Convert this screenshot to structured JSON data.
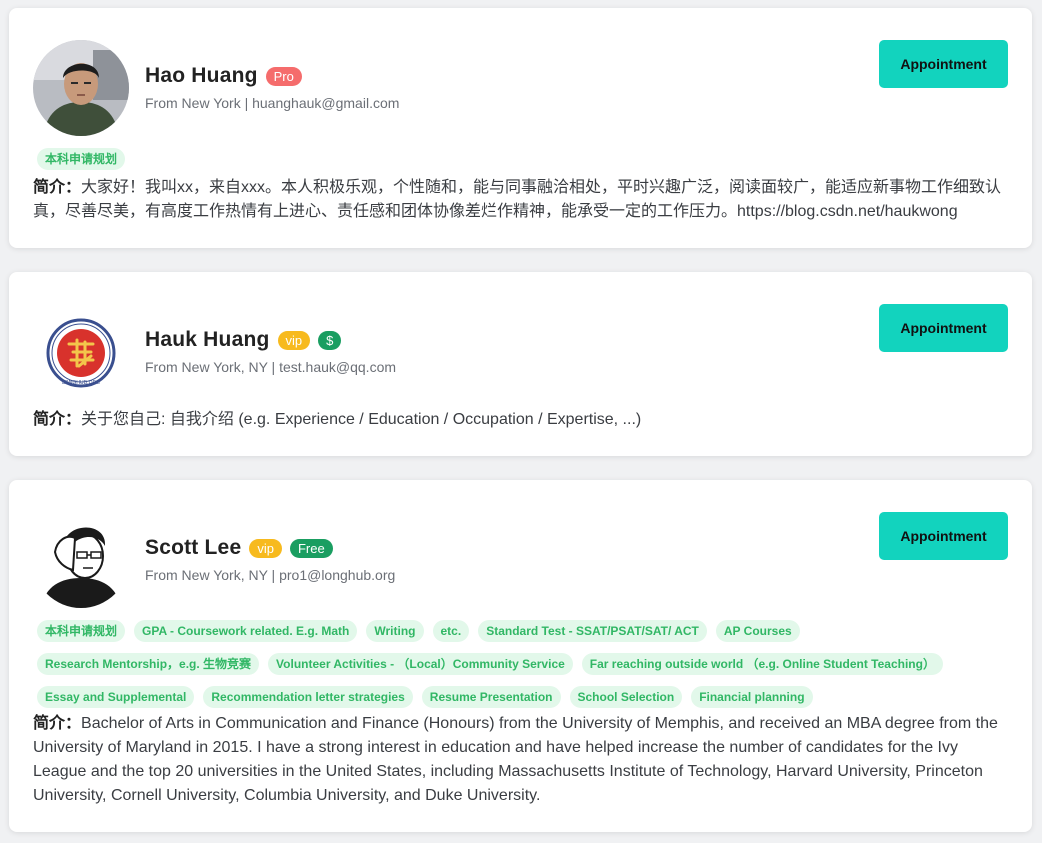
{
  "cards": [
    {
      "name": "Hao Huang",
      "badges": [
        "Pro"
      ],
      "from": "From New York | huanghauk@gmail.com",
      "appointment_label": "Appointment",
      "tags": [
        "本科申请规划"
      ],
      "bio_label": "简介：",
      "bio": "大家好！我叫xx，来自xxx。本人积极乐观，个性随和，能与同事融洽相处，平时兴趣广泛，阅读面较广，能适应新事物工作细致认真，尽善尽美，有高度工作热情有上进心、责任感和团体协像差烂作精神，能承受一定的工作压力。https://blog.csdn.net/haukwong"
    },
    {
      "name": "Hauk Huang",
      "badges": [
        "vip",
        "$"
      ],
      "from": "From New York, NY | test.hauk@qq.com",
      "appointment_label": "Appointment",
      "tags": [],
      "bio_label": "简介：",
      "bio": "关于您自己: 自我介绍 (e.g. Experience / Education / Occupation / Expertise, ...)",
      "logo_text": "LONGHUB.ORG"
    },
    {
      "name": "Scott Lee",
      "badges": [
        "vip",
        "Free"
      ],
      "from": "From New York, NY | pro1@longhub.org",
      "appointment_label": "Appointment",
      "tags": [
        "本科申请规划",
        "GPA - Coursework related. E.g. Math",
        "Writing",
        "etc.",
        "Standard Test - SSAT/PSAT/SAT/ ACT",
        "AP Courses",
        "Research Mentorship，e.g. 生物竞赛",
        "Volunteer Activities - （Local）Community Service",
        "Far reaching outside world （e.g. Online Student Teaching）",
        "Essay and Supplemental",
        "Recommendation letter strategies",
        "Resume Presentation",
        "School Selection",
        "Financial planning"
      ],
      "bio_label": "简介：",
      "bio": "Bachelor of Arts in Communication and Finance (Honours) from the University of Memphis, and received an MBA degree from the University of Maryland in 2015. I have a strong interest in education and have helped increase the number of candidates for the Ivy League and the top 20 universities in the United States, including Massachusetts Institute of Technology, Harvard University, Princeton University, Cornell University, Columbia University, and Duke University."
    }
  ],
  "colors": {
    "appointment": "#12d3be",
    "pro_badge": "#f56c6c",
    "vip_badge": "#f7ba1e",
    "green_badge": "#1a9e61",
    "tag_bg": "#e2f8ea",
    "tag_text": "#31b765"
  }
}
